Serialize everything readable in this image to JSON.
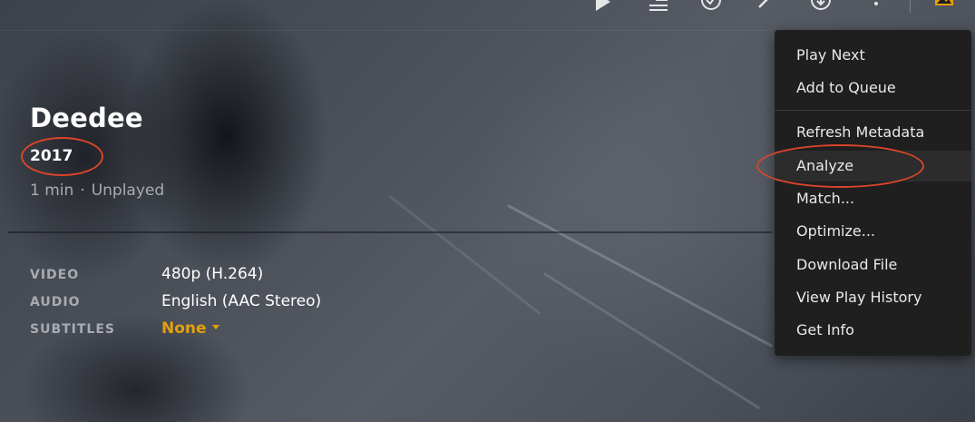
{
  "toolbar": {
    "icons": [
      "play-icon",
      "add-to-queue-icon",
      "mark-watched-icon",
      "edit-icon",
      "download-icon",
      "more-icon",
      "artwork-icon"
    ]
  },
  "item": {
    "title": "Deedee",
    "year": "2017",
    "duration": "1 min",
    "separator": "·",
    "status": "Unplayed"
  },
  "details": {
    "video_label": "VIDEO",
    "video_value": "480p (H.264)",
    "audio_label": "AUDIO",
    "audio_value": "English (AAC Stereo)",
    "subtitles_label": "SUBTITLES",
    "subtitles_value": "None"
  },
  "menu": {
    "items": [
      "Play Next",
      "Add to Queue",
      "Refresh Metadata",
      "Analyze",
      "Match...",
      "Optimize...",
      "Download File",
      "View Play History",
      "Get Info"
    ],
    "highlighted": "Analyze"
  },
  "colors": {
    "accent": "#e5a00d",
    "annotation": "#d9452b",
    "menu_bg": "#1f1f1f"
  }
}
